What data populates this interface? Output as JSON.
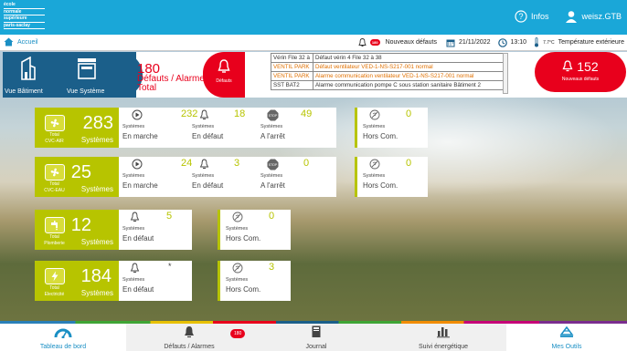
{
  "topbar": {
    "logo_lines": [
      "école",
      "normale",
      "supérieure",
      "paris-saclay"
    ],
    "infos_label": "Infos",
    "user_label": "weisz.GTB"
  },
  "subbar": {
    "home_label": "Accueil",
    "new_alarm_badge": "180",
    "new_alarms_label": "Nouveaux défauts",
    "date": "21/11/2022",
    "time": "13:10",
    "temperature": "7.7°C",
    "temperature_label": "Température extérieure"
  },
  "header": {
    "vue_batiment": "Vue Bâtiment",
    "vue_systeme": "Vue Système",
    "alarm_total": "180",
    "alarm_line1": "Défauts / Alarmes",
    "alarm_line2": "Total",
    "defauts_label": "Défauts",
    "new_defauts_count": "152",
    "new_defauts_label": "Nouveaux défauts",
    "alarm_rows": [
      {
        "source": "Vérin File 32 à",
        "message": "Défaut vérin 4 File 32 à 38",
        "warn": false
      },
      {
        "source": "VENTIL PARK",
        "message": "Défaut ventilateur VED-1-NS-S217-001 normal",
        "warn": true
      },
      {
        "source": "VENTIL PARK",
        "message": "Alarme communication ventilateur VED-1-NS-S217-001 normal",
        "warn": true
      },
      {
        "source": "SST BAT2",
        "message": "Alarme communication pompe C sous station sanitaire Bâtiment 2",
        "warn": false
      }
    ]
  },
  "groups": [
    {
      "total": "283",
      "total_label": "Total",
      "name": "CVC-AIR",
      "sys": "Systèmes",
      "stats": [
        {
          "value": "232",
          "sys": "Systèmes",
          "state": "En marche"
        },
        {
          "value": "18",
          "sys": "Systèmes",
          "state": "En défaut"
        },
        {
          "value": "49",
          "sys": "Systèmes",
          "state": "A l'arrêt"
        }
      ],
      "offline": {
        "value": "0",
        "sys": "Systèmes",
        "state": "Hors Com."
      }
    },
    {
      "total": "25",
      "total_label": "Total",
      "name": "CVC-EAU",
      "sys": "Systèmes",
      "stats": [
        {
          "value": "24",
          "sys": "Systèmes",
          "state": "En marche"
        },
        {
          "value": "3",
          "sys": "Systèmes",
          "state": "En défaut"
        },
        {
          "value": "0",
          "sys": "Systèmes",
          "state": "A l'arrêt"
        }
      ],
      "offline": {
        "value": "0",
        "sys": "Systèmes",
        "state": "Hors Com."
      }
    },
    {
      "total": "12",
      "total_label": "Total",
      "name": "Plomberie",
      "sys": "Systèmes",
      "stats": [
        {
          "value": "5",
          "sys": "Systèmes",
          "state": "En défaut"
        }
      ],
      "offline": {
        "value": "0",
        "sys": "Systèmes",
        "state": "Hors Com."
      }
    },
    {
      "total": "184",
      "total_label": "Total",
      "name": "Electricité",
      "sys": "Systèmes",
      "stats": [
        {
          "value": "*",
          "sys": "Systèmes",
          "state": "En défaut"
        }
      ],
      "offline": {
        "value": "3",
        "sys": "Systèmes",
        "state": "Hors Com."
      }
    }
  ],
  "nav": {
    "dashboard": "Tableau de bord",
    "alarms": "Défauts / Alarmes",
    "alarms_badge": "180",
    "journal": "Journal",
    "energy": "Suivi énergétique",
    "tools": "Mes Outils"
  },
  "colors": {
    "accent": "#b7c400",
    "alert": "#e8001c",
    "brand": "#1aa7d8",
    "dark": "#1b5f8a"
  }
}
